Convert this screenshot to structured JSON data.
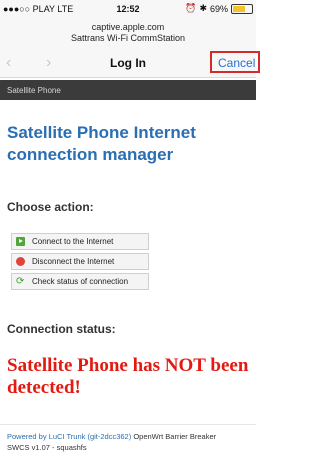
{
  "status_bar": {
    "carrier": "●●●○○ PLAY  LTE",
    "time": "12:52",
    "battery": "69%",
    "battery_level": 0.69
  },
  "url_bar": {
    "domain": "captive.apple.com",
    "page_title": "Sattrans Wi-Fi CommStation"
  },
  "nav": {
    "back_glyph": "‹",
    "forward_glyph": "›",
    "title": "Log In",
    "cancel_label": "Cancel"
  },
  "header_bar": {
    "label": "Satellite Phone"
  },
  "main": {
    "heading": "Satellite Phone Internet connection manager",
    "choose_action_label": "Choose action:",
    "actions": [
      {
        "label": "Connect to the Internet",
        "icon": "play-green-icon"
      },
      {
        "label": "Disconnect the Internet",
        "icon": "stop-red-icon"
      },
      {
        "label": "Check status of connection",
        "icon": "refresh-icon"
      }
    ],
    "status_label": "Connection status:",
    "status_message": "Satellite Phone has NOT been detected!"
  },
  "footer": {
    "link_text": "Powered by LuCI Trunk (git-2dcc362)",
    "line1_rest": " OpenWrt Barrier Breaker",
    "line2": "SWCS v1.07 - squashfs"
  },
  "colors": {
    "heading": "#2a6fb3",
    "alert": "#e21b12",
    "cancel_border": "#d62a2a",
    "dark_bar": "#3b3b3b"
  }
}
